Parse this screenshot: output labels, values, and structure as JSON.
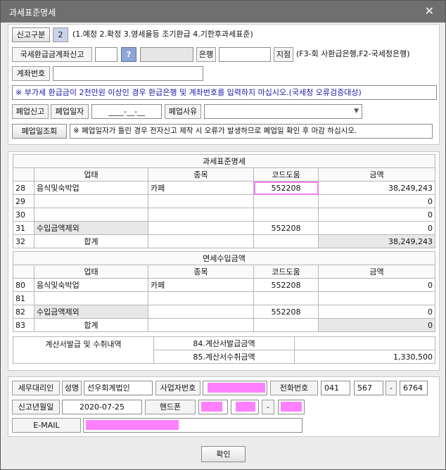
{
  "window": {
    "title": "과세표준명세",
    "close_symbol": "✕"
  },
  "report": {
    "type_label": "신고구분",
    "type_value": "2",
    "type_hint": "(1.예정 2.확정 3.영세율등 조기환급 4.기한후과세표준)"
  },
  "refund": {
    "label": "국세환급금계좌신고",
    "code": "",
    "help": "?",
    "bank_name": "",
    "bank_label": "은행",
    "branch_value": "",
    "branch_label": "지점",
    "hint": "(F3-회 사환급은행,F2-국세청은행)"
  },
  "account": {
    "label": "계좌번호",
    "value": "",
    "notice": "※ 부가세 환급금이 2천만원 이상인 경우 환급은행 및 계좌번호를 입력하지 마십시오.(국세청 오류검증대상)"
  },
  "closure": {
    "report_label": "폐업신고",
    "date_label": "폐업일자",
    "date_value": "____-__-__",
    "reason_label": "폐업사유",
    "reason_value": "",
    "arrow": "▼",
    "inquiry_button": "폐업일조회",
    "notice": "※ 폐업일자가 틀린 경우 전자신고 제작 시 오류가 발생하므로 폐업일 확인 후 마감 하십시오."
  },
  "tax_base": {
    "title": "과세표준명세",
    "headers": [
      "업태",
      "종목",
      "코드도움",
      "금액"
    ],
    "rows": [
      {
        "no": "28",
        "type": "음식및숙박업",
        "item": "카페",
        "code": "552208",
        "amount": "38,249,243"
      },
      {
        "no": "29",
        "type": "",
        "item": "",
        "code": "",
        "amount": "0"
      },
      {
        "no": "30",
        "type": "",
        "item": "",
        "code": "",
        "amount": "0"
      },
      {
        "no": "31",
        "type": "수입금액제외",
        "item": "",
        "code": "552208",
        "amount": "0"
      },
      {
        "no": "32",
        "type": "합계",
        "item": "",
        "code": "",
        "amount": "38,249,243"
      }
    ]
  },
  "exempt": {
    "title": "면세수입금액",
    "headers": [
      "업태",
      "종목",
      "코드도움",
      "금액"
    ],
    "rows": [
      {
        "no": "80",
        "type": "음식및숙박업",
        "item": "카페",
        "code": "552208",
        "amount": "0"
      },
      {
        "no": "81",
        "type": "",
        "item": "",
        "code": "",
        "amount": ""
      },
      {
        "no": "82",
        "type": "수입금액제외",
        "item": "",
        "code": "552208",
        "amount": "0"
      },
      {
        "no": "83",
        "type": "합계",
        "item": "",
        "code": "",
        "amount": "0"
      }
    ]
  },
  "invoice": {
    "label": "계산서발급 및 수취내역",
    "issued_label": "84.계산서발급금액",
    "issued_value": "",
    "received_label": "85.계산서수취금액",
    "received_value": "1,330,500"
  },
  "agent": {
    "label": "세무대리인",
    "name_label": "성명",
    "name_value": "선우회계법인",
    "bizno_label": "사업자번호",
    "phone_label": "전화번호",
    "phone1": "041",
    "phone2": "567",
    "dash": "-",
    "phone3": "6764",
    "date_label": "신고년월일",
    "date_value": "2020-07-25",
    "mobile_label": "핸드폰",
    "email_label": "E-MAIL",
    "colors": {
      "redaction": "#ff80ff"
    }
  },
  "footer": {
    "ok_button": "확인"
  }
}
